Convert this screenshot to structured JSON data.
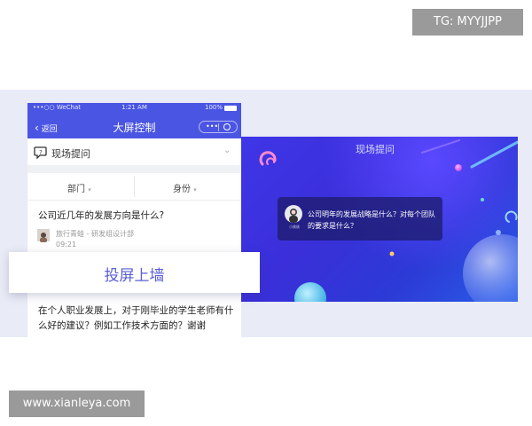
{
  "watermark_top": "TG: MYYJJPP",
  "watermark_bottom": "www.xianleya.com",
  "phone": {
    "status": {
      "carrier": "WeChat",
      "time": "1:21 AM",
      "battery": "100%"
    },
    "nav": {
      "back_label": "返回",
      "title": "大屏控制"
    },
    "section_label": "现场提问",
    "filters": {
      "left": "部门",
      "right": "身份"
    },
    "question1": {
      "text": "公司近几年的发展方向是什么?",
      "author": "旅行青蛙 - 研发组设计部",
      "time": "09:21"
    },
    "overlay_button": "投屏上墙",
    "question2": "在个人职业发展上，对于刚毕业的学生老师有什么好的建议？例如工作技术方面的？谢谢"
  },
  "screen": {
    "title": "现场提问",
    "card_text": "公司明年的发展战略是什么？对每个团队的要求是什么？",
    "card_name": "小佛佛"
  },
  "colors": {
    "brand": "#4a55e3",
    "overlay_text": "#5a5fd6",
    "screen_bg": "#3a2fd9"
  }
}
